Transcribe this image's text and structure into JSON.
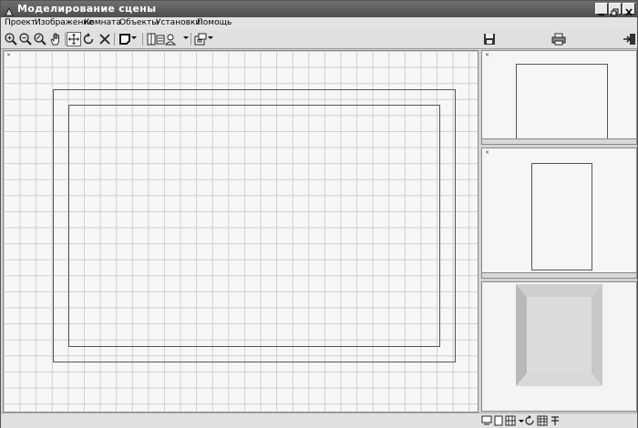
{
  "window": {
    "title": "Моделирование сцены"
  },
  "menu": {
    "items": [
      "Проект",
      "Изображение",
      "Комната",
      "Объекты",
      "Установки",
      "Помощь"
    ]
  },
  "toolbar": {
    "left_icons": [
      "zoom-in-icon",
      "zoom-out-icon",
      "zoom-fit-icon",
      "pan-hand-icon",
      "move-icon",
      "rotate-icon",
      "delete-icon",
      "room-shape-icon",
      "view-modes-icon",
      "object-library-icon"
    ],
    "right_icons": [
      "save-icon",
      "print-icon",
      "exit-icon"
    ]
  },
  "canvas": {
    "corner_marker": "×"
  },
  "panels": {
    "corner_marker": "×"
  },
  "statusbar": {
    "icons": [
      "view-top-icon",
      "view-front-icon",
      "view-grid-icon",
      "view-rotate-icon",
      "view-table-icon",
      "view-settings-icon"
    ]
  },
  "colors": {
    "titlebar": "#5a5a5a",
    "grid": "#cfcfcf",
    "canvas_bg": "#f7f7f7"
  }
}
